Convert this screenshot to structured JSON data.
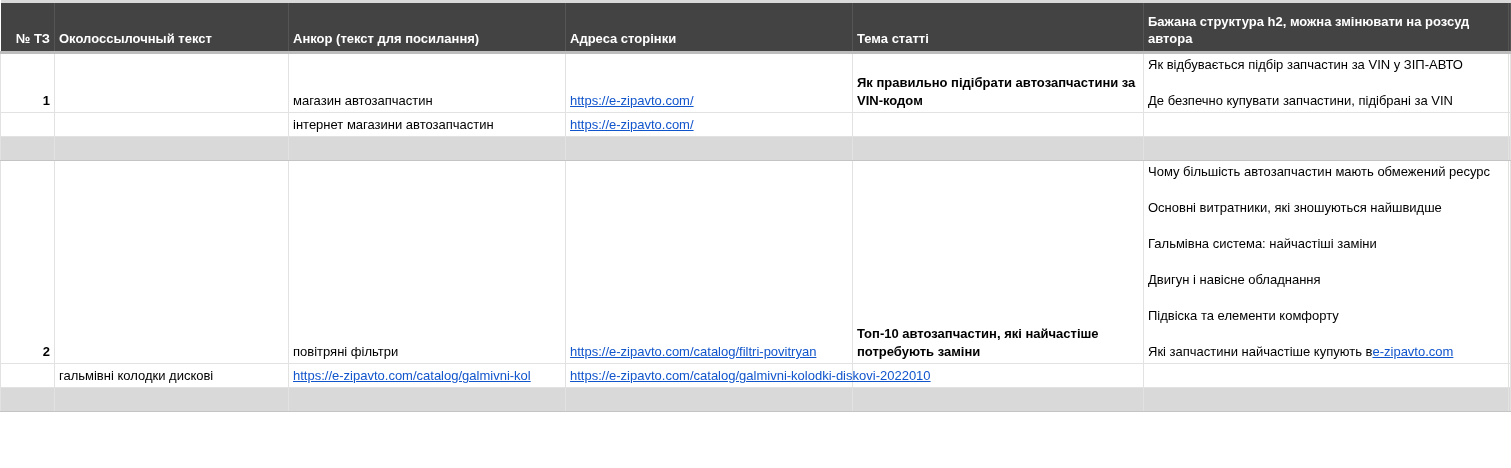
{
  "table": {
    "columns": [
      "№ ТЗ",
      "Околоссылочный текст",
      "Анкор (текст для посилання)",
      "Адреса сторінки",
      "Тема статті",
      "Бажана структура h2, можна змінювати на розсуд автора"
    ],
    "rows": [
      {
        "kind": "item",
        "number": "1",
        "anchor": "магазин автозапчастин",
        "url": "https://e-zipavto.com/",
        "topic": "Як правильно підібрати автозапчастини за VIN-кодом",
        "h2": [
          {
            "text": "Як відбувається підбір запчастин за VIN у ЗІП-АВТО"
          },
          {
            "text": "Де безпечно купувати запчастини, підібрані за VIN"
          }
        ]
      },
      {
        "kind": "item",
        "anchor": "інтернет магазини автозапчастин",
        "url": "https://e-zipavto.com/"
      },
      {
        "kind": "separator"
      },
      {
        "kind": "item",
        "number": "2",
        "anchor": "повітряні фільтри",
        "url": "https://e-zipavto.com/catalog/filtri-povitryan",
        "topic": "Топ-10 автозапчастин, які найчастіше потребують заміни",
        "h2": [
          {
            "text": "Чому більшість автозапчастин мають обмежений ресурс"
          },
          {
            "text": "Основні витратники, які зношуються найшвидше"
          },
          {
            "text": "Гальмівна система: найчастіші заміни"
          },
          {
            "text": "Двигун і навісне обладнання"
          },
          {
            "text": "Підвіска та елементи комфорту"
          },
          {
            "text": "Які запчастини найчастіше купують в",
            "link": "e-zipavto.com"
          }
        ]
      },
      {
        "kind": "item",
        "context": "гальмівні колодки дискові",
        "anchor_link": "https://e-zipavto.com/catalog/galmivni-kol",
        "url": "https://e-zipavto.com/catalog/galmivni-kolodki-diskovi-2022010"
      },
      {
        "kind": "separator"
      }
    ]
  }
}
